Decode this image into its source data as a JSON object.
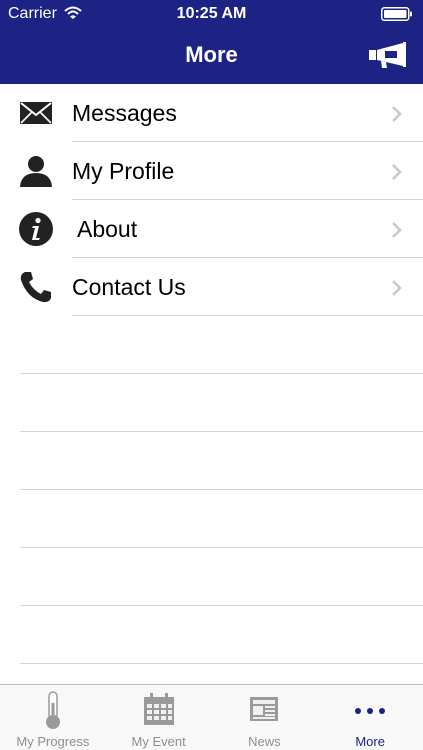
{
  "status_bar": {
    "carrier": "Carrier",
    "time": "10:25 AM"
  },
  "nav": {
    "title": "More"
  },
  "menu": {
    "items": [
      {
        "label": "Messages",
        "icon": "envelope-icon"
      },
      {
        "label": "My Profile",
        "icon": "person-icon"
      },
      {
        "label": "About",
        "icon": "info-icon"
      },
      {
        "label": "Contact Us",
        "icon": "phone-icon"
      }
    ]
  },
  "tabs": [
    {
      "label": "My Progress",
      "icon": "thermometer-icon",
      "active": false
    },
    {
      "label": "My Event",
      "icon": "calendar-icon",
      "active": false
    },
    {
      "label": "News",
      "icon": "newspaper-icon",
      "active": false
    },
    {
      "label": "More",
      "icon": "more-dots-icon",
      "active": true
    }
  ],
  "colors": {
    "nav_background": "#1d2384",
    "active_tab": "#1d2384",
    "inactive_tab": "#8e8e93",
    "separator": "#d4d4d4"
  }
}
